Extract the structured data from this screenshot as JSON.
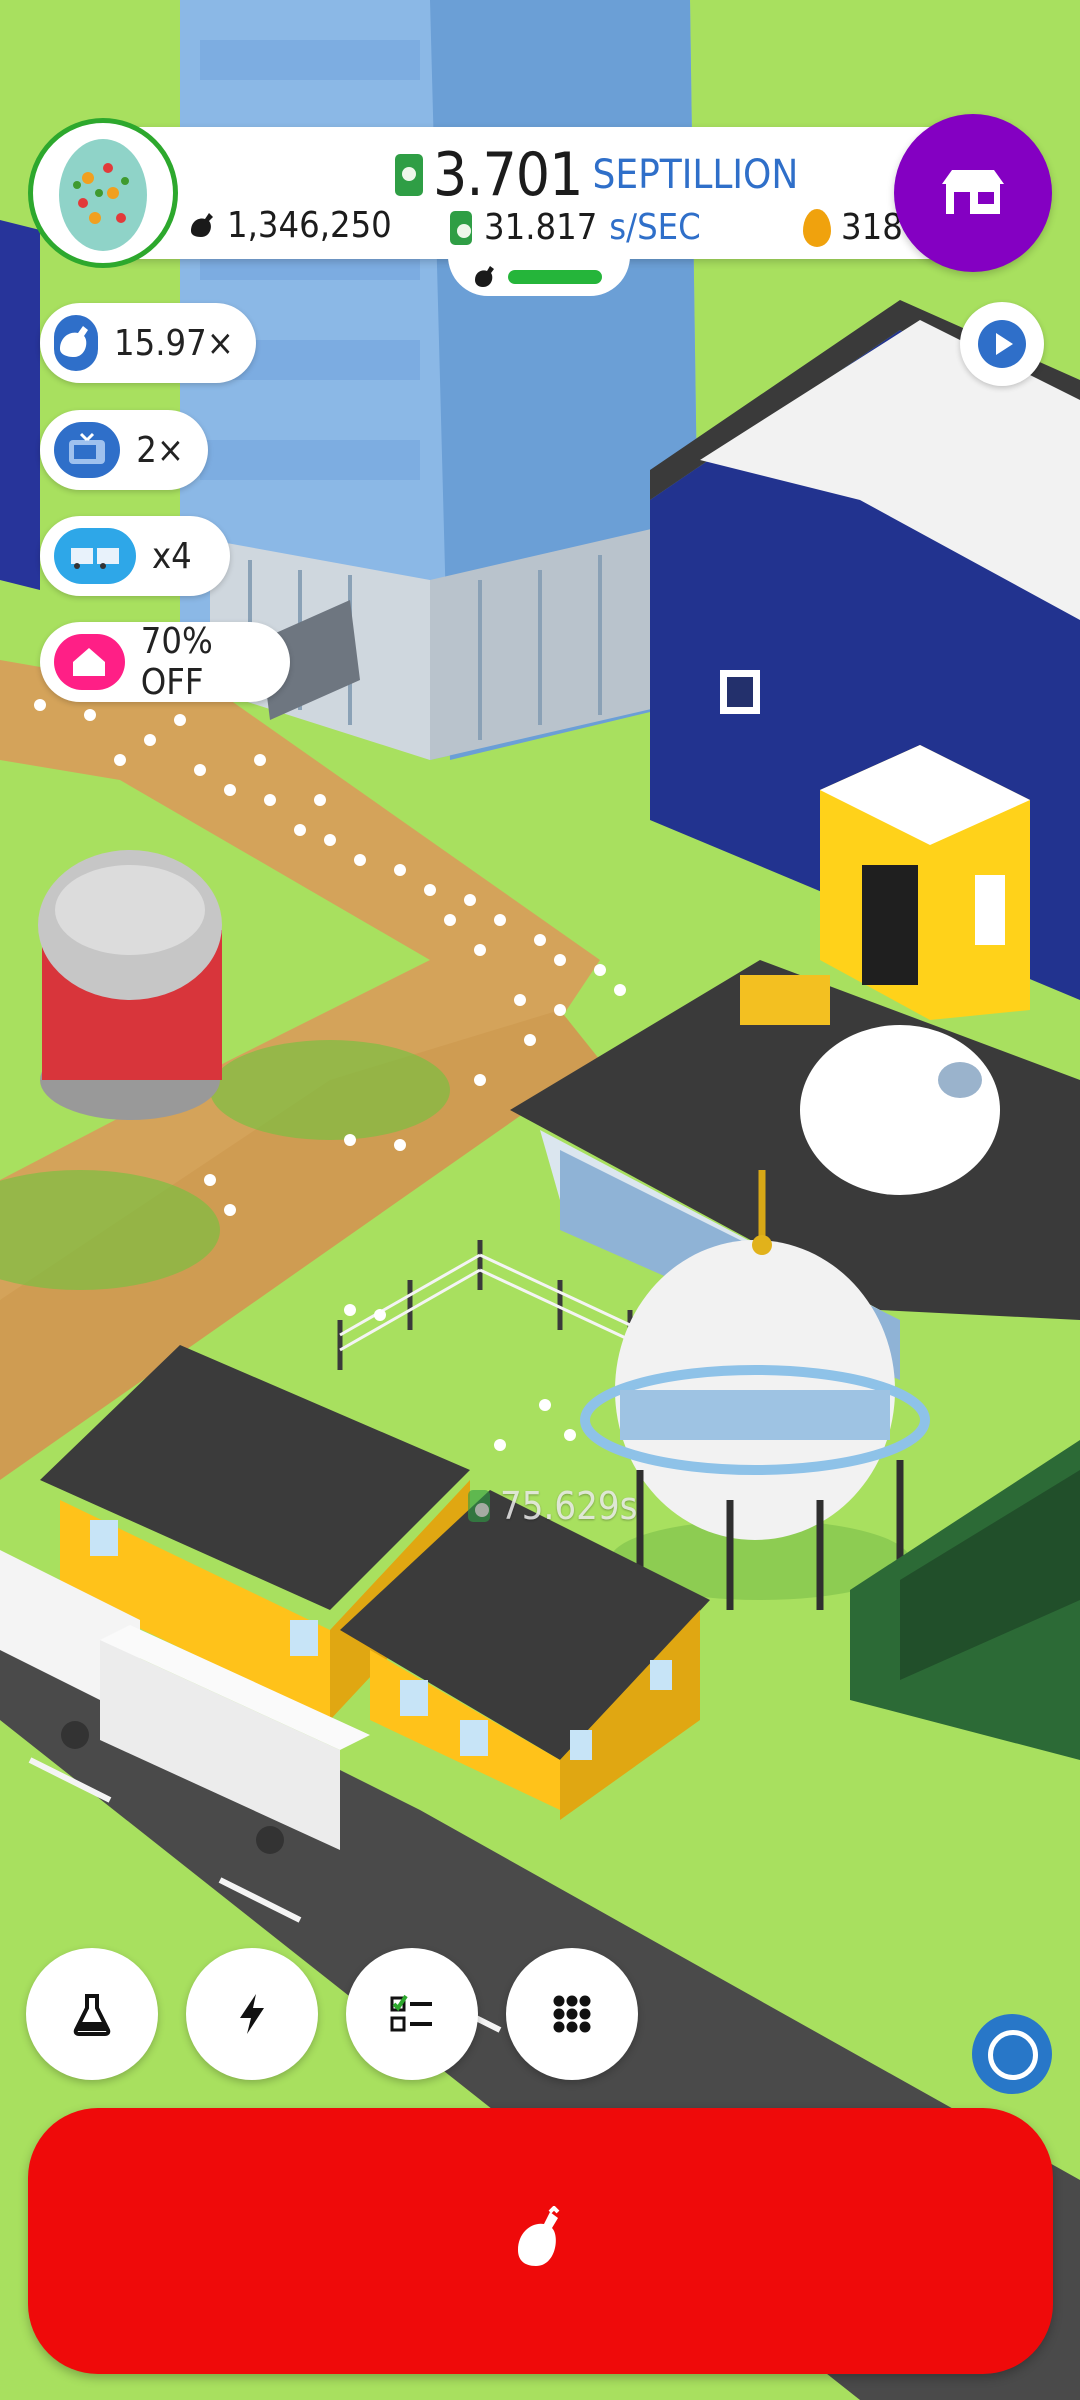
{
  "hud": {
    "cash_value": "3.701",
    "cash_unit": "SEPTILLION",
    "chickens": "1,346,250",
    "rate_value": "31.817",
    "rate_unit": "s/SEC",
    "golden_eggs": "318"
  },
  "boosts": [
    {
      "label": "15.97×",
      "icon": "chicken-icon",
      "color": "#2f6fc9"
    },
    {
      "label": "2×",
      "icon": "tv-icon",
      "color": "#2f6fc9"
    },
    {
      "label": "x4",
      "icon": "trucks-icon",
      "color": "#2ea7e8"
    },
    {
      "label": "70% OFF",
      "icon": "house-icon",
      "color": "#ff1f86"
    }
  ],
  "float_text": "75.629s",
  "toolbar": [
    "lab-icon",
    "lightning-icon",
    "checklist-icon",
    "grid-icon"
  ],
  "colors": {
    "grass": "#a8e05f",
    "shop_purple": "#8400c2",
    "hatch_red": "#ef0a0a",
    "accent_blue": "#2f6fc9"
  }
}
